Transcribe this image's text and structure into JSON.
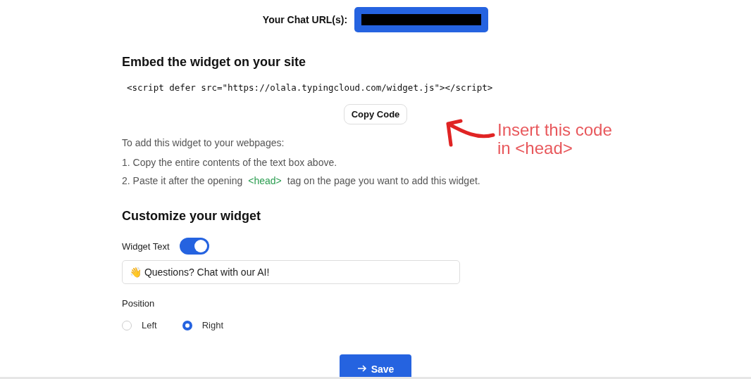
{
  "chat_url": {
    "label": "Your Chat URL(s):",
    "redacted": true
  },
  "embed": {
    "heading": "Embed the widget on your site",
    "code": "<script defer src=\"https://olala.typingcloud.com/widget.js\"></script>",
    "copy_button": "Copy Code",
    "intro": "To add this widget to your webpages:",
    "steps": [
      {
        "number": "1.",
        "parts": [
          {
            "kind": "text",
            "text": "Copy the entire contents of the text box above."
          }
        ]
      },
      {
        "number": "2.",
        "parts": [
          {
            "kind": "text",
            "text": "Paste it after the opening"
          },
          {
            "kind": "tag",
            "text": "<head>"
          },
          {
            "kind": "text",
            "text": "tag on the page you want to add this widget."
          }
        ]
      }
    ]
  },
  "annotation": {
    "lines": [
      "Insert this code",
      "in <head>"
    ]
  },
  "customize": {
    "heading": "Customize your widget",
    "widget_text": {
      "label": "Widget Text",
      "on": true,
      "value": "👋 Questions? Chat with our AI!"
    },
    "position": {
      "label": "Position",
      "options": [
        {
          "label": "Left",
          "selected": false
        },
        {
          "label": "Right",
          "selected": true
        }
      ]
    }
  },
  "save_button": "Save"
}
